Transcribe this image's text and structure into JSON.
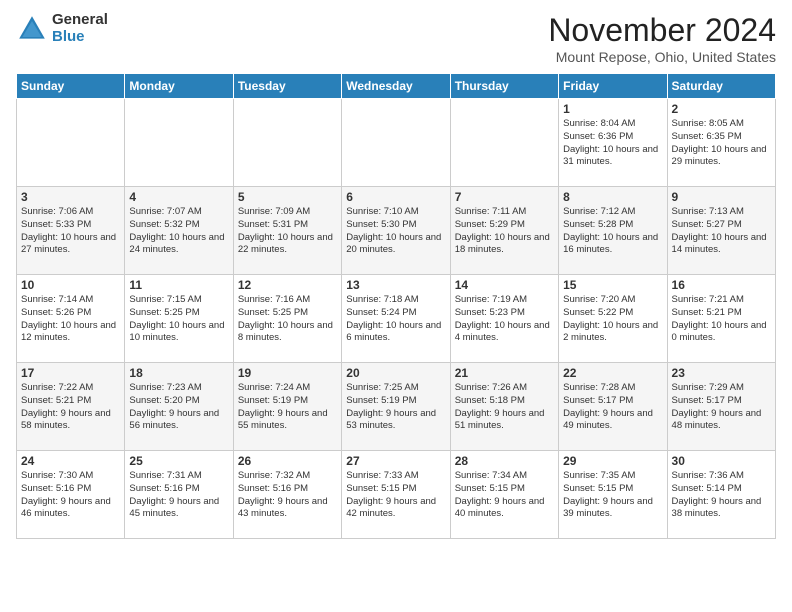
{
  "header": {
    "logo_general": "General",
    "logo_blue": "Blue",
    "month_title": "November 2024",
    "location": "Mount Repose, Ohio, United States"
  },
  "weekdays": [
    "Sunday",
    "Monday",
    "Tuesday",
    "Wednesday",
    "Thursday",
    "Friday",
    "Saturday"
  ],
  "weeks": [
    [
      {
        "day": "",
        "info": ""
      },
      {
        "day": "",
        "info": ""
      },
      {
        "day": "",
        "info": ""
      },
      {
        "day": "",
        "info": ""
      },
      {
        "day": "",
        "info": ""
      },
      {
        "day": "1",
        "info": "Sunrise: 8:04 AM\nSunset: 6:36 PM\nDaylight: 10 hours and 31 minutes."
      },
      {
        "day": "2",
        "info": "Sunrise: 8:05 AM\nSunset: 6:35 PM\nDaylight: 10 hours and 29 minutes."
      }
    ],
    [
      {
        "day": "3",
        "info": "Sunrise: 7:06 AM\nSunset: 5:33 PM\nDaylight: 10 hours and 27 minutes."
      },
      {
        "day": "4",
        "info": "Sunrise: 7:07 AM\nSunset: 5:32 PM\nDaylight: 10 hours and 24 minutes."
      },
      {
        "day": "5",
        "info": "Sunrise: 7:09 AM\nSunset: 5:31 PM\nDaylight: 10 hours and 22 minutes."
      },
      {
        "day": "6",
        "info": "Sunrise: 7:10 AM\nSunset: 5:30 PM\nDaylight: 10 hours and 20 minutes."
      },
      {
        "day": "7",
        "info": "Sunrise: 7:11 AM\nSunset: 5:29 PM\nDaylight: 10 hours and 18 minutes."
      },
      {
        "day": "8",
        "info": "Sunrise: 7:12 AM\nSunset: 5:28 PM\nDaylight: 10 hours and 16 minutes."
      },
      {
        "day": "9",
        "info": "Sunrise: 7:13 AM\nSunset: 5:27 PM\nDaylight: 10 hours and 14 minutes."
      }
    ],
    [
      {
        "day": "10",
        "info": "Sunrise: 7:14 AM\nSunset: 5:26 PM\nDaylight: 10 hours and 12 minutes."
      },
      {
        "day": "11",
        "info": "Sunrise: 7:15 AM\nSunset: 5:25 PM\nDaylight: 10 hours and 10 minutes."
      },
      {
        "day": "12",
        "info": "Sunrise: 7:16 AM\nSunset: 5:25 PM\nDaylight: 10 hours and 8 minutes."
      },
      {
        "day": "13",
        "info": "Sunrise: 7:18 AM\nSunset: 5:24 PM\nDaylight: 10 hours and 6 minutes."
      },
      {
        "day": "14",
        "info": "Sunrise: 7:19 AM\nSunset: 5:23 PM\nDaylight: 10 hours and 4 minutes."
      },
      {
        "day": "15",
        "info": "Sunrise: 7:20 AM\nSunset: 5:22 PM\nDaylight: 10 hours and 2 minutes."
      },
      {
        "day": "16",
        "info": "Sunrise: 7:21 AM\nSunset: 5:21 PM\nDaylight: 10 hours and 0 minutes."
      }
    ],
    [
      {
        "day": "17",
        "info": "Sunrise: 7:22 AM\nSunset: 5:21 PM\nDaylight: 9 hours and 58 minutes."
      },
      {
        "day": "18",
        "info": "Sunrise: 7:23 AM\nSunset: 5:20 PM\nDaylight: 9 hours and 56 minutes."
      },
      {
        "day": "19",
        "info": "Sunrise: 7:24 AM\nSunset: 5:19 PM\nDaylight: 9 hours and 55 minutes."
      },
      {
        "day": "20",
        "info": "Sunrise: 7:25 AM\nSunset: 5:19 PM\nDaylight: 9 hours and 53 minutes."
      },
      {
        "day": "21",
        "info": "Sunrise: 7:26 AM\nSunset: 5:18 PM\nDaylight: 9 hours and 51 minutes."
      },
      {
        "day": "22",
        "info": "Sunrise: 7:28 AM\nSunset: 5:17 PM\nDaylight: 9 hours and 49 minutes."
      },
      {
        "day": "23",
        "info": "Sunrise: 7:29 AM\nSunset: 5:17 PM\nDaylight: 9 hours and 48 minutes."
      }
    ],
    [
      {
        "day": "24",
        "info": "Sunrise: 7:30 AM\nSunset: 5:16 PM\nDaylight: 9 hours and 46 minutes."
      },
      {
        "day": "25",
        "info": "Sunrise: 7:31 AM\nSunset: 5:16 PM\nDaylight: 9 hours and 45 minutes."
      },
      {
        "day": "26",
        "info": "Sunrise: 7:32 AM\nSunset: 5:16 PM\nDaylight: 9 hours and 43 minutes."
      },
      {
        "day": "27",
        "info": "Sunrise: 7:33 AM\nSunset: 5:15 PM\nDaylight: 9 hours and 42 minutes."
      },
      {
        "day": "28",
        "info": "Sunrise: 7:34 AM\nSunset: 5:15 PM\nDaylight: 9 hours and 40 minutes."
      },
      {
        "day": "29",
        "info": "Sunrise: 7:35 AM\nSunset: 5:15 PM\nDaylight: 9 hours and 39 minutes."
      },
      {
        "day": "30",
        "info": "Sunrise: 7:36 AM\nSunset: 5:14 PM\nDaylight: 9 hours and 38 minutes."
      }
    ]
  ]
}
